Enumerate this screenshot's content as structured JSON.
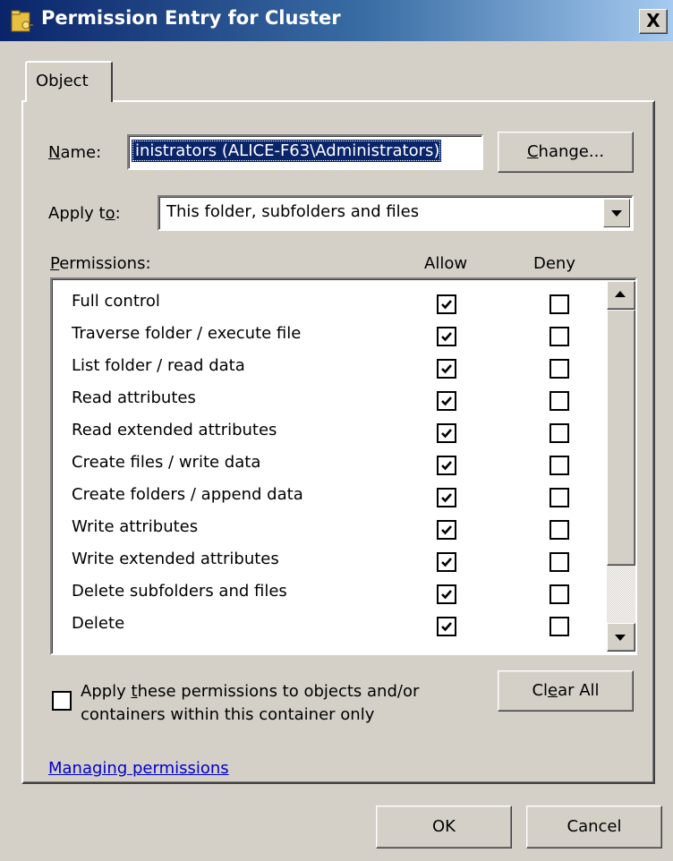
{
  "window": {
    "title": "Permission Entry for Cluster",
    "close_label": "X"
  },
  "tabs": [
    {
      "label": "Object"
    }
  ],
  "name_field": {
    "label_first": "N",
    "label_rest": "ame:",
    "value": "inistrators (ALICE-F63\\Administrators)"
  },
  "change_button": {
    "label_first": "C",
    "label_rest": "hange..."
  },
  "apply_to": {
    "label_pre": "Apply t",
    "label_ul": "o",
    "label_post": ":",
    "value": "This folder, subfolders and files"
  },
  "permissions": {
    "label_first": "P",
    "label_rest": "ermissions:",
    "allow_header": "Allow",
    "deny_header": "Deny",
    "items": [
      {
        "name": "Full control",
        "allow": true,
        "deny": false
      },
      {
        "name": "Traverse folder / execute file",
        "allow": true,
        "deny": false
      },
      {
        "name": "List folder / read data",
        "allow": true,
        "deny": false
      },
      {
        "name": "Read attributes",
        "allow": true,
        "deny": false
      },
      {
        "name": "Read extended attributes",
        "allow": true,
        "deny": false
      },
      {
        "name": "Create files / write data",
        "allow": true,
        "deny": false
      },
      {
        "name": "Create folders / append data",
        "allow": true,
        "deny": false
      },
      {
        "name": "Write attributes",
        "allow": true,
        "deny": false
      },
      {
        "name": "Write extended attributes",
        "allow": true,
        "deny": false
      },
      {
        "name": "Delete subfolders and files",
        "allow": true,
        "deny": false
      },
      {
        "name": "Delete",
        "allow": true,
        "deny": false
      }
    ]
  },
  "apply_only": {
    "checked": false,
    "line1_pre": "Apply ",
    "line1_ul": "t",
    "line1_post": "hese permissions to objects and/or",
    "line2": "containers within this container only"
  },
  "clear_all_button": {
    "label_pre": "Cl",
    "label_ul": "e",
    "label_post": "ar All"
  },
  "managing_link": "Managing permissions",
  "ok_button": "OK",
  "cancel_button": "Cancel",
  "colors": {
    "accent": "#0a246a",
    "face": "#d4d0c8",
    "link": "#0000cc"
  }
}
